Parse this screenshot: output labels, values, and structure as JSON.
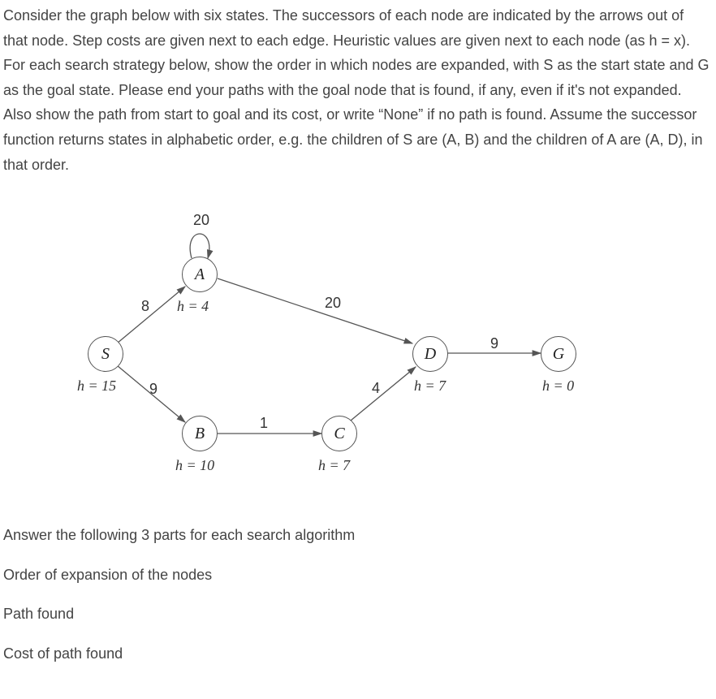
{
  "problem": {
    "text": "Consider the graph below with six states. The successors of each node are indicated by the arrows out of that node. Step costs are given next to each edge. Heuristic values are given next to each node (as h = x). For each search strategy below, show the order in which nodes are expanded, with S as the start state and G as the goal state. Please end your paths with the goal node that is found, if any, even if it's not expanded. Also show the path from start to goal and its cost, or write “None” if no path is found. Assume the successor function returns states in alphabetic order, e.g. the children of S are (A, B) and the children of A are (A, D), in that order."
  },
  "graph": {
    "nodes": {
      "S": {
        "label": "S",
        "h": "h = 15"
      },
      "A": {
        "label": "A",
        "h": "h = 4"
      },
      "B": {
        "label": "B",
        "h": "h = 10"
      },
      "C": {
        "label": "C",
        "h": "h = 7"
      },
      "D": {
        "label": "D",
        "h": "h = 7"
      },
      "G": {
        "label": "G",
        "h": "h = 0"
      }
    },
    "edges": {
      "AA": "20",
      "SA": "8",
      "SB": "9",
      "AD": "20",
      "BC": "1",
      "CD": "4",
      "DG": "9"
    }
  },
  "questions": {
    "intro": "Answer the following 3 parts for each search algorithm",
    "q1": "Order of expansion of the nodes",
    "q2": "Path found",
    "q3": "Cost of path found"
  },
  "chart_data": {
    "type": "diagram",
    "title": "Search graph with six states",
    "nodes": [
      {
        "id": "S",
        "heuristic": 15
      },
      {
        "id": "A",
        "heuristic": 4
      },
      {
        "id": "B",
        "heuristic": 10
      },
      {
        "id": "C",
        "heuristic": 7
      },
      {
        "id": "D",
        "heuristic": 7
      },
      {
        "id": "G",
        "heuristic": 0
      }
    ],
    "edges": [
      {
        "from": "A",
        "to": "A",
        "cost": 20
      },
      {
        "from": "S",
        "to": "A",
        "cost": 8
      },
      {
        "from": "S",
        "to": "B",
        "cost": 9
      },
      {
        "from": "A",
        "to": "D",
        "cost": 20
      },
      {
        "from": "B",
        "to": "C",
        "cost": 1
      },
      {
        "from": "C",
        "to": "D",
        "cost": 4
      },
      {
        "from": "D",
        "to": "G",
        "cost": 9
      }
    ],
    "start": "S",
    "goal": "G"
  }
}
